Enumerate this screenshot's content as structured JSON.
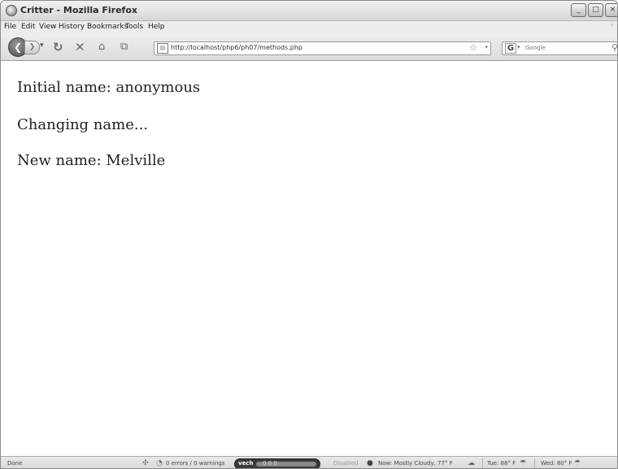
{
  "window": {
    "title": "Critter - Mozilla Firefox",
    "controls": [
      "_",
      "□",
      "×"
    ]
  },
  "menu": [
    "File",
    "Edit",
    "View",
    "History",
    "Bookmarks",
    "Tools",
    "Help"
  ],
  "nav": {
    "back_icon": "back-arrow-icon",
    "url": "http://localhost/php6/ph07/methods.php",
    "search_engine": "G",
    "search_placeholder": "Google"
  },
  "content": {
    "lines": [
      "Initial name: anonymous",
      "Changing name...",
      "New name: Melville"
    ]
  },
  "status": {
    "done": "Done",
    "errors": "0 errors / 0 warnings",
    "vech_label": "vech",
    "vech_values": "0  0  0",
    "disabled": "Disabled",
    "weather_now": "Now: Mostly Cloudy, 77° F",
    "weather_tue": "Tue: 88° F",
    "weather_wed": "Wed: 80° F"
  }
}
